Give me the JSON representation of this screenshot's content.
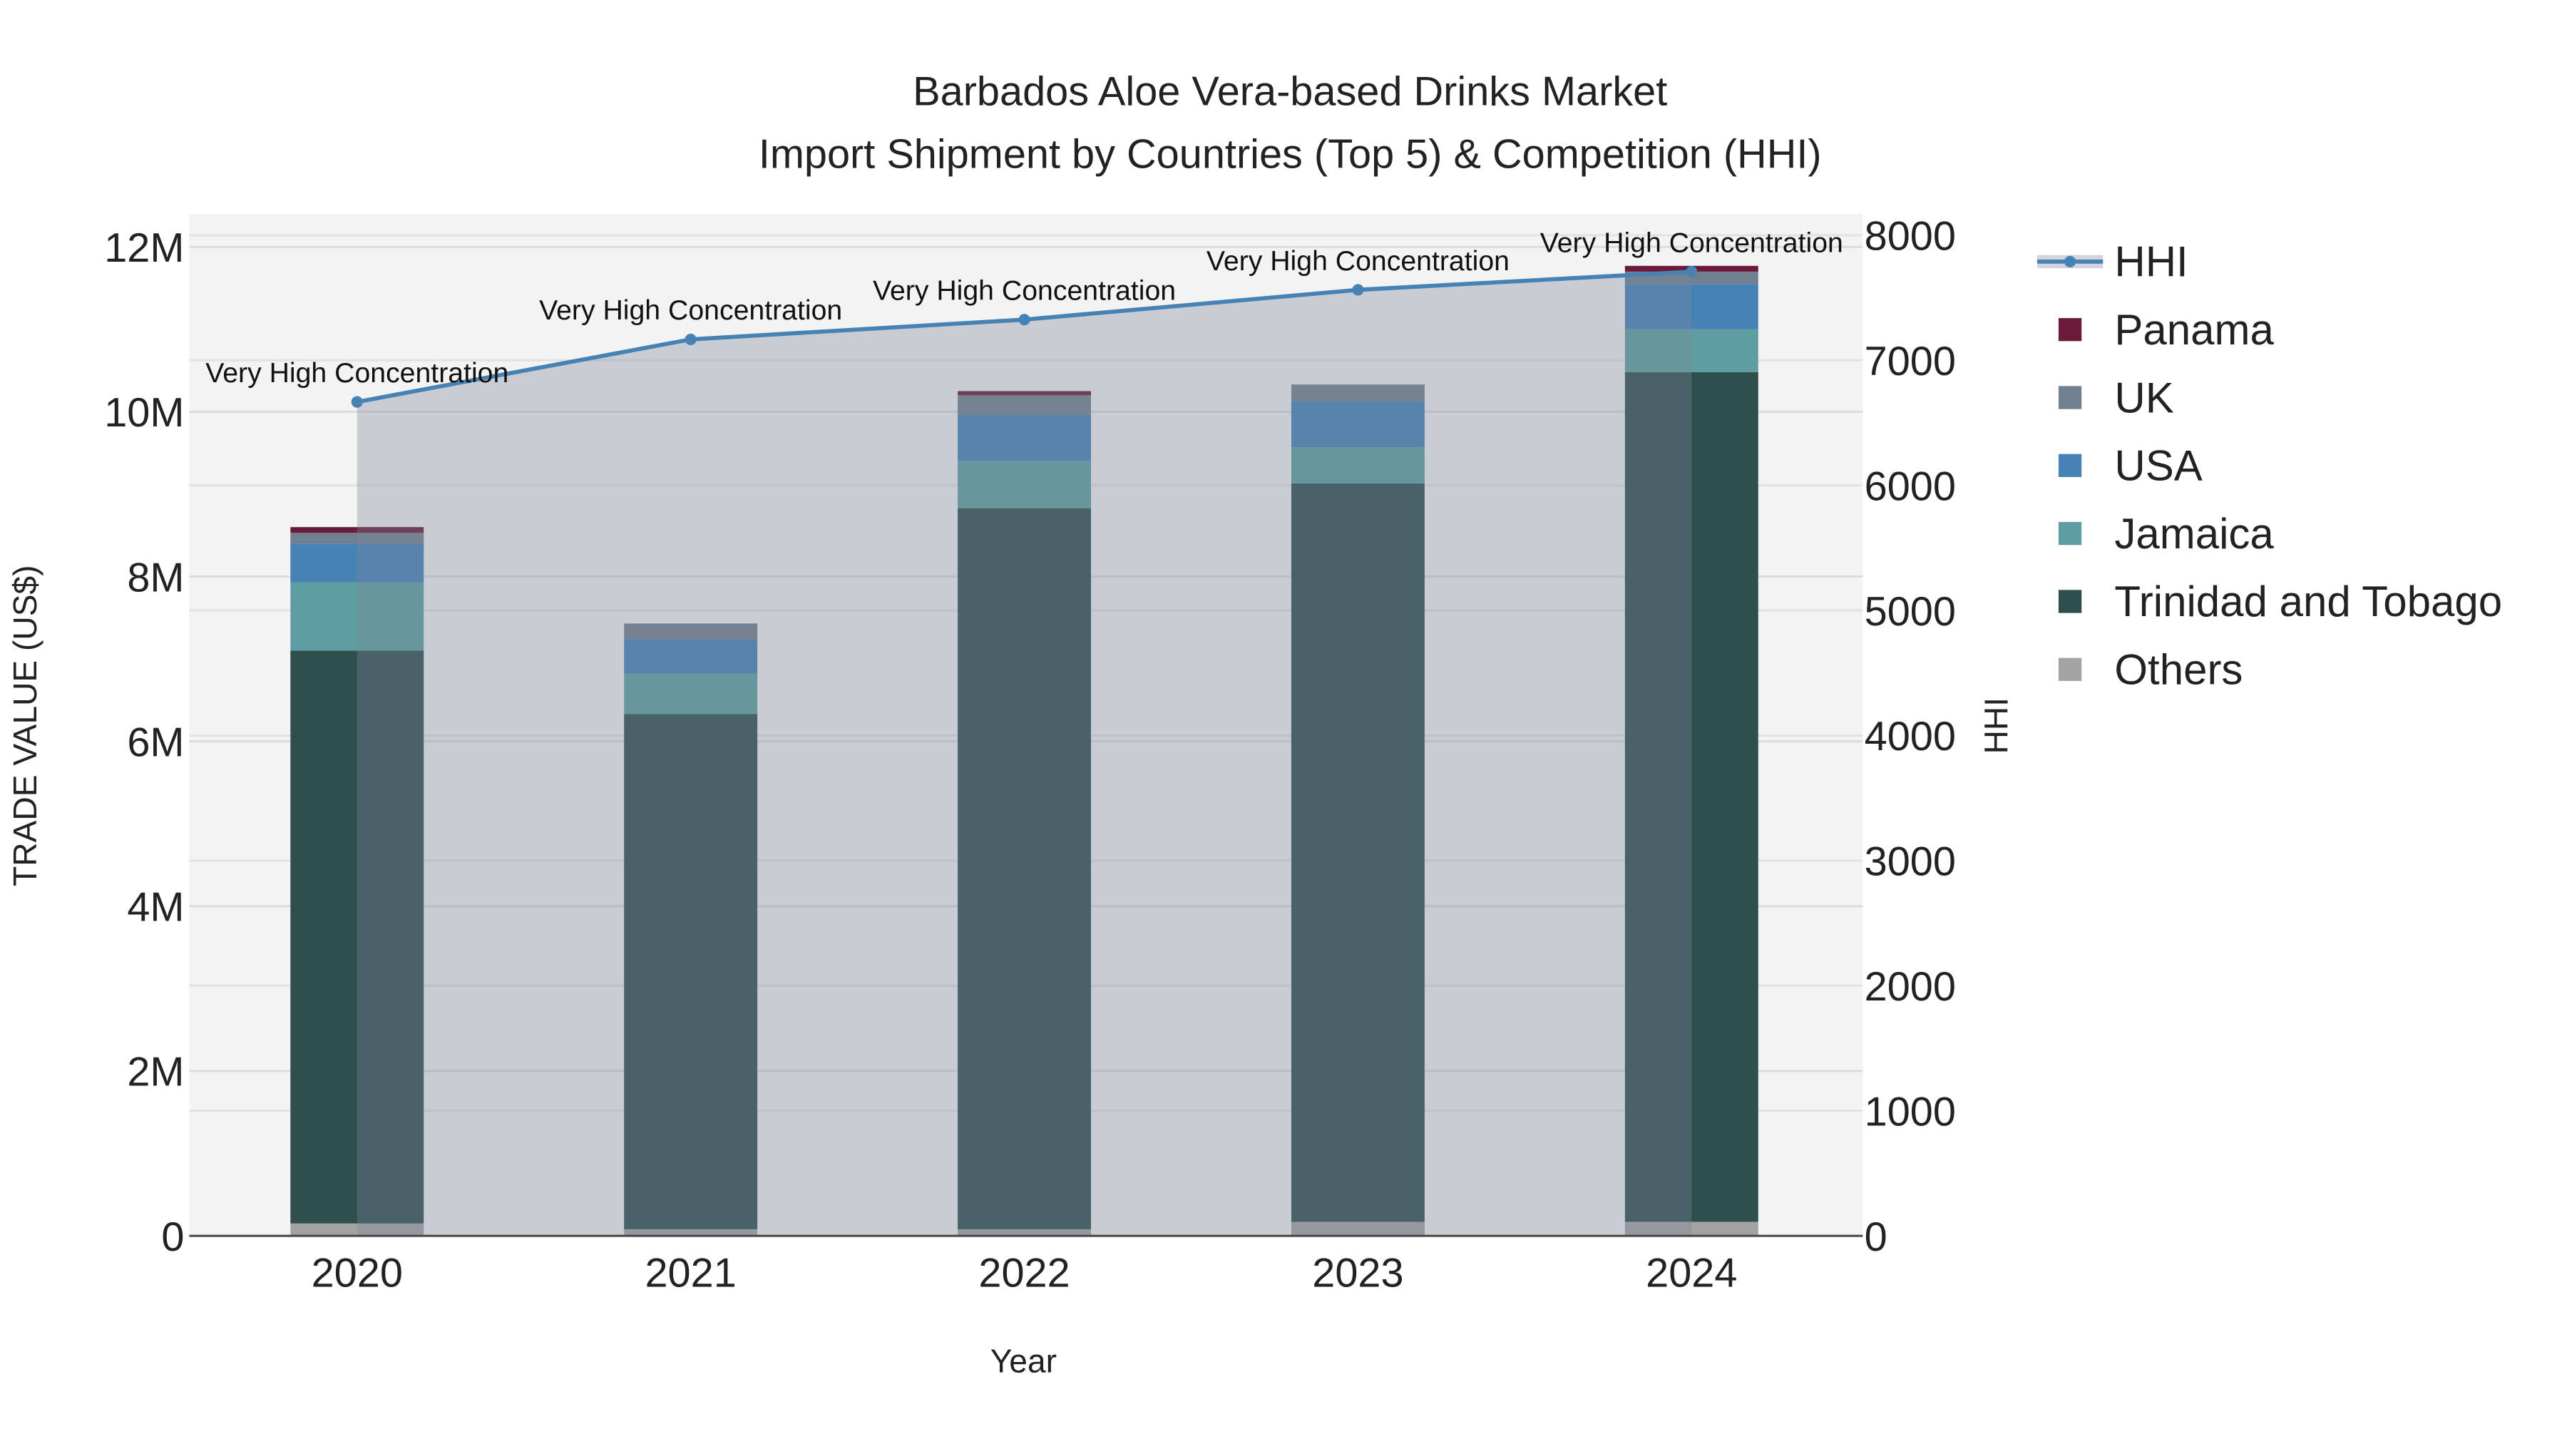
{
  "chart_data": {
    "type": "bar",
    "stacked": true,
    "title": "Barbados Aloe Vera-based Drinks Market",
    "subtitle": "Import Shipment by Countries (Top 5) & Competition (HHI)",
    "xlabel": "Year",
    "ylabel": "TRADE VALUE (US$)",
    "y2label": "HHI",
    "categories": [
      "2020",
      "2021",
      "2022",
      "2023",
      "2024"
    ],
    "ylim": [
      0,
      12400000
    ],
    "y2lim": [
      0,
      8170
    ],
    "yticks": [
      {
        "v": 0,
        "label": "0"
      },
      {
        "v": 2000000,
        "label": "2M"
      },
      {
        "v": 4000000,
        "label": "4M"
      },
      {
        "v": 6000000,
        "label": "6M"
      },
      {
        "v": 8000000,
        "label": "8M"
      },
      {
        "v": 10000000,
        "label": "10M"
      },
      {
        "v": 12000000,
        "label": "12M"
      }
    ],
    "y2ticks": [
      "0",
      "1000",
      "2000",
      "3000",
      "4000",
      "5000",
      "6000",
      "7000",
      "8000"
    ],
    "grid": true,
    "legend_position": "right",
    "series": [
      {
        "name": "Others",
        "color": "#a3a3a3",
        "values": [
          150000,
          80000,
          80000,
          170000,
          170000
        ]
      },
      {
        "name": "Trinidad and Tobago",
        "color": "#2f4f4f",
        "values": [
          6950000,
          6250000,
          8750000,
          8960000,
          10310000
        ]
      },
      {
        "name": "Jamaica",
        "color": "#5f9ea0",
        "values": [
          830000,
          490000,
          570000,
          440000,
          520000
        ]
      },
      {
        "name": "USA",
        "color": "#4682b4",
        "values": [
          470000,
          420000,
          560000,
          560000,
          550000
        ]
      },
      {
        "name": "UK",
        "color": "#708090",
        "values": [
          130000,
          190000,
          240000,
          200000,
          150000
        ]
      },
      {
        "name": "Panama",
        "color": "#6b1a3a",
        "values": [
          70000,
          0,
          50000,
          0,
          70000
        ]
      }
    ],
    "line": {
      "name": "HHI",
      "color": "#4682b4",
      "values": [
        6667,
        7167,
        7325,
        7563,
        7708
      ],
      "annotations": [
        "Very High Concentration",
        "Very High Concentration",
        "Very High Concentration",
        "Very High Concentration",
        "Very High Concentration"
      ]
    },
    "legend_order": [
      "HHI",
      "Panama",
      "UK",
      "USA",
      "Jamaica",
      "Trinidad and Tobago",
      "Others"
    ]
  }
}
